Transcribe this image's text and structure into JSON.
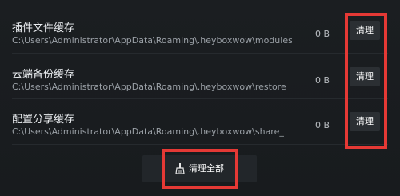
{
  "cache_items": [
    {
      "name": "插件文件缓存",
      "path": "C:\\Users\\Administrator\\AppData\\Roaming\\.heyboxwow\\modules",
      "size": "0 B",
      "clear_label": "清理"
    },
    {
      "name": "云端备份缓存",
      "path": "C:\\Users\\Administrator\\AppData\\Roaming\\.heyboxwow\\restore",
      "size": "0 B",
      "clear_label": "清理"
    },
    {
      "name": "配置分享缓存",
      "path": "C:\\Users\\Administrator\\AppData\\Roaming\\.heyboxwow\\share_",
      "size": "0 B",
      "clear_label": "清理"
    }
  ],
  "footer": {
    "clear_all_label": "清理全部",
    "clear_all_icon": "broom-icon"
  },
  "colors": {
    "background": "#1b1e21",
    "button": "#2b2f33",
    "annotation": "#e53935"
  }
}
